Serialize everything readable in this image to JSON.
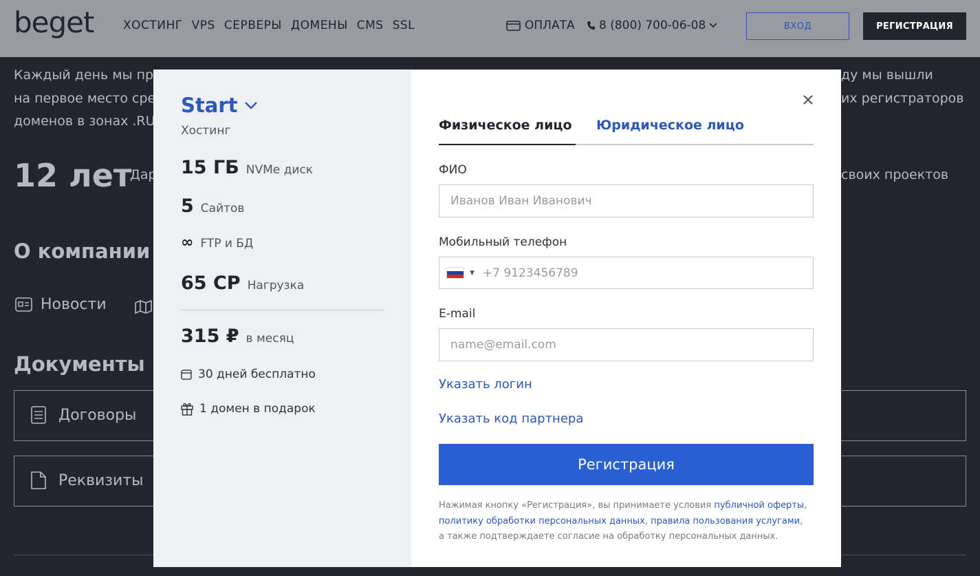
{
  "header": {
    "logo": "beget",
    "nav": [
      "ХОСТИНГ",
      "VPS",
      "СЕРВЕРЫ",
      "ДОМЕНЫ",
      "CMS",
      "SSL"
    ],
    "pay_label": "ОПЛАТА",
    "phone": "8 (800) 700-06-08",
    "login_label": "ВХОД",
    "register_label": "РЕГИСТРАЦИЯ"
  },
  "background": {
    "line1_left": "Каждый день мы пре",
    "line1_right": "ду мы вышли",
    "line2_left": "на первое место сред",
    "line2_right": "их регистраторов",
    "line3_left": "доменов в зонах .RU",
    "years": "12 лет",
    "years_sub": "Дар",
    "years_right": "своих проектов",
    "about_title": "О компании",
    "news_label": "Новости",
    "docs_title": "Документы",
    "contracts_label": "Договоры",
    "requisites_label": "Реквизиты"
  },
  "plan": {
    "name": "Start",
    "category": "Хостинг",
    "features": [
      {
        "value": "15 ГБ",
        "label": "NVMe диск"
      },
      {
        "value": "5",
        "label": "Сайтов"
      },
      {
        "value": "∞",
        "label": "FTP и БД"
      },
      {
        "value": "65 CP",
        "label": "Нагрузка"
      }
    ],
    "price": "315 ₽",
    "price_period": "в месяц",
    "perks": [
      "30 дней бесплатно",
      "1 домен в подарок"
    ]
  },
  "form": {
    "tab_individual": "Физическое лицо",
    "tab_legal": "Юридическое лицо",
    "fio_label": "ФИО",
    "fio_placeholder": "Иванов Иван Иванович",
    "phone_label": "Мобильный телефон",
    "phone_placeholder": "+7 9123456789",
    "email_label": "E-mail",
    "email_placeholder": "name@email.com",
    "login_link": "Указать логин",
    "partner_link": "Указать код партнера",
    "submit_label": "Регистрация",
    "legal_text_1": "Нажимая кнопку «Регистрация», вы принимаете условия ",
    "legal_link_offer": "публичной оферты",
    "legal_sep_1": ",",
    "legal_link_privacy": "политику обработки персональных данных",
    "legal_sep_2": ", ",
    "legal_link_rules": "правила пользования услугами",
    "legal_sep_3": ",",
    "legal_text_2": "а также подтверждаете согласие на обработку персональных данных."
  },
  "colors": {
    "accent": "#2d58b6",
    "button": "#2a5fd1",
    "dark": "#24242f"
  }
}
